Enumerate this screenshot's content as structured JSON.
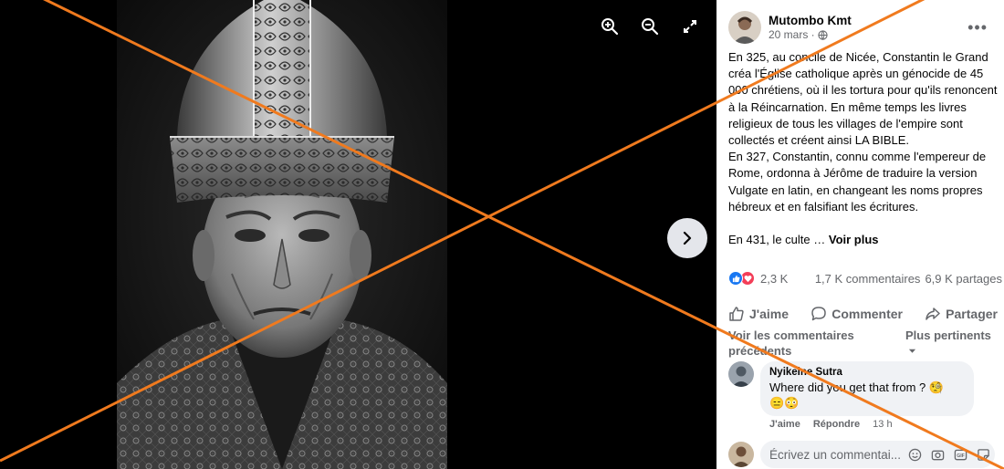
{
  "viewer": {
    "tools": [
      "zoom-in-icon",
      "zoom-out-icon",
      "fullscreen-icon"
    ],
    "next": "chevron-right-icon"
  },
  "post": {
    "author": "Mutombo Kmt",
    "time": "20 mars ·",
    "audience_icon": "globe-icon",
    "more": "•••",
    "paragraphs": [
      "En 325, au concile de Nicée, Constantin le Grand créa l'Église catholique après un génocide de 45 000 chrétiens, où il les tortura pour qu'ils renoncent à la Réincarnation. En même temps les livres religieux de tous les villages de l'empire sont collectés et créent ainsi LA BIBLE.",
      "En 327, Constantin, connu comme l'empereur de Rome, ordonna à Jérôme de traduire la version Vulgate en latin, en changeant les noms propres hébreux et en falsifiant les écritures."
    ],
    "truncated": "En 431, le culte …",
    "see_more": "Voir plus"
  },
  "stats": {
    "reactions": "2,3 K",
    "comments": "1,7 K commentaires",
    "shares": "6,9 K partages"
  },
  "actions": {
    "like": "J'aime",
    "comment": "Commenter",
    "share": "Partager"
  },
  "comments": {
    "previous": "Voir les commentaires précédents",
    "sort": "Plus pertinents",
    "items": [
      {
        "author": "Nyikeine Sutra",
        "text": "Where did you get that from ? 🧐",
        "emojis": "😑😳",
        "like": "J'aime",
        "reply": "Répondre",
        "time": "13 h"
      }
    ]
  },
  "composer": {
    "placeholder": "Écrivez un commentai..."
  },
  "colors": {
    "overlay": "#f07a1e",
    "like": "#1877f2",
    "love": "#f33e58"
  }
}
